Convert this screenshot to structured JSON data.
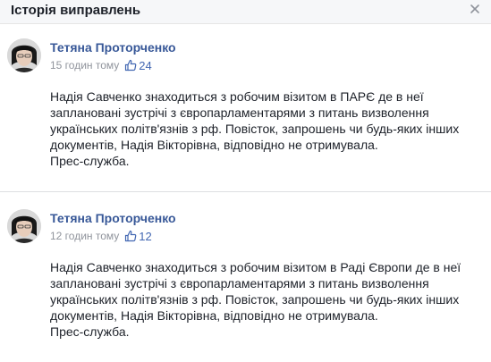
{
  "dialog": {
    "title": "Історія виправлень"
  },
  "revisions": [
    {
      "author": "Тетяна Проторченко",
      "time": "15 годин тому",
      "likes": "24",
      "lines": [
        "Надія Савченко знаходиться з робочим візитом в ПАРЄ де в неї",
        "заплановані зустрічі з європарламентарями з питань визволення",
        "українських політв'язнів з рф. Повісток, запрошень чи будь-яких інших",
        "документів, Надія Вікторівна, відповідно не отримувала.",
        "Прес-служба."
      ]
    },
    {
      "author": "Тетяна Проторченко",
      "time": "12 годин тому",
      "likes": "12",
      "lines": [
        "Надія Савченко знаходиться з робочим візитом в Раді Європи де в неї",
        "заплановані зустрічі з європарламентарями з питань визволення",
        "українських політв'язнів з рф. Повісток, запрошень чи будь-яких інших",
        "документів, Надія Вікторівна, відповідно не отримувала.",
        "Прес-служба."
      ]
    }
  ]
}
